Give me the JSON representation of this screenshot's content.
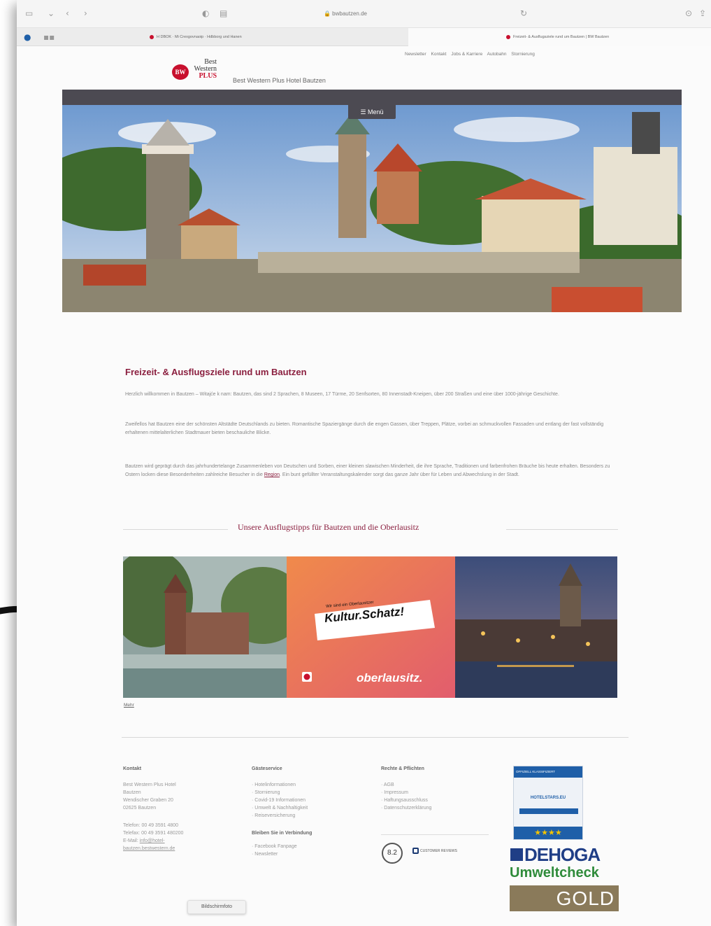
{
  "browser": {
    "url": "bwbautzen.de",
    "tabs": [
      {
        "label": "H DBOK · Mi Crexgovnaoip · Hdbborg und Hanen"
      },
      {
        "label": "Freizeit- & Ausflugsziele rund um Bautzen | BW Bautzen"
      }
    ]
  },
  "header": {
    "topnav": [
      "Newsletter",
      "Kontakt",
      "Jobs & Karriere",
      "Autobahn",
      "Stornierung"
    ],
    "logo": {
      "line1": "Best",
      "line2": "Western",
      "line3": "PLUS",
      "badge": "BW"
    },
    "site_title": "Best Western Plus Hotel Bautzen",
    "menu_label": "☰ Menü"
  },
  "main": {
    "heading": "Freizeit- & Ausflugsziele rund um Bautzen",
    "para1": "Herzlich willkommen in Bautzen – Witajće k nam: Bautzen, das sind 2 Sprachen, 8 Museen, 17 Türme, 20 Senfsorten, 80 Innenstadt-Kneipen, über 200 Straßen und eine über 1000-jährige Geschichte.",
    "para2": "Zweifellos hat Bautzen eine der schönsten Altstädte Deutschlands zu bieten. Romantische Spaziergänge durch die engen Gassen, über Treppen, Plätze, vorbei an schmuckvollen Fassaden und entlang der fast vollständig erhaltenen mittelalterlichen Stadtmauer bieten beschauliche Blicke.",
    "para3_a": "Bautzen wird geprägt durch das jahrhundertelange Zusammenleben von Deutschen und Sorben, einer kleinen slawischen Minderheit, die ihre Sprache, Traditionen und farbenfrohen Bräuche bis heute erhalten. Besonders zu Ostern locken diese Besonderheiten zahlreiche Besucher in die",
    "para3_link": "Region",
    "para3_b": ". Ein bunt gefüllter Veranstaltungskalender sorgt das ganze Jahr über für Leben und Abwechslung in der Stadt.",
    "section_title": "Unsere Ausflugstipps für Bautzen und die Oberlausitz",
    "tile_small": "Wir sind ein Oberlausitzer",
    "tile_big": "Kultur.Schatz!",
    "tile_brand": "oberlausitz.",
    "more_link": "Mehr"
  },
  "footer": {
    "contact": {
      "heading": "Kontakt",
      "lines": [
        "Best Western Plus Hotel",
        "Bautzen",
        "Wendischer Graben 20",
        "02625 Bautzen"
      ],
      "phone": "Telefon: 00 49 3591 4800",
      "fax": "Telefax: 00 49 3591 480200",
      "email_label": "E-Mail:",
      "email_a": "info@hotel-",
      "email_b": "bautzen.bestwestern.de"
    },
    "guest": {
      "heading": "Gästeservice",
      "items": [
        "Hotelinformationen",
        "Stornierung",
        "Covid-19 Informationen",
        "Umwelt & Nachhaltigkeit",
        "Reiseversicherung"
      ],
      "stay_heading": "Bleiben Sie in Verbindung",
      "stay_items": [
        "Facebook Fanpage",
        "Newsletter"
      ]
    },
    "rights": {
      "heading": "Rechte & Pflichten",
      "items": [
        "AGB",
        "Impressum",
        "Haftungsausschluss",
        "Datenschutzerklärung"
      ],
      "rating": "8.2",
      "badge": "CUSTOMER REVIEWS"
    },
    "awards": {
      "hs_top": "OFFIZIELL KLASSIFIZIERT",
      "hs_name": "HOTELSTARS.EU",
      "hs_stars": "★★★★",
      "dehoga": "DEHOGA",
      "umwelt": "Umweltcheck",
      "gold": "GOLD"
    }
  },
  "tooltip": "Bildschirmfoto",
  "colors": {
    "accent": "#8b1f3f",
    "bw_red": "#c8102e",
    "menubar": "#4c4a52"
  }
}
